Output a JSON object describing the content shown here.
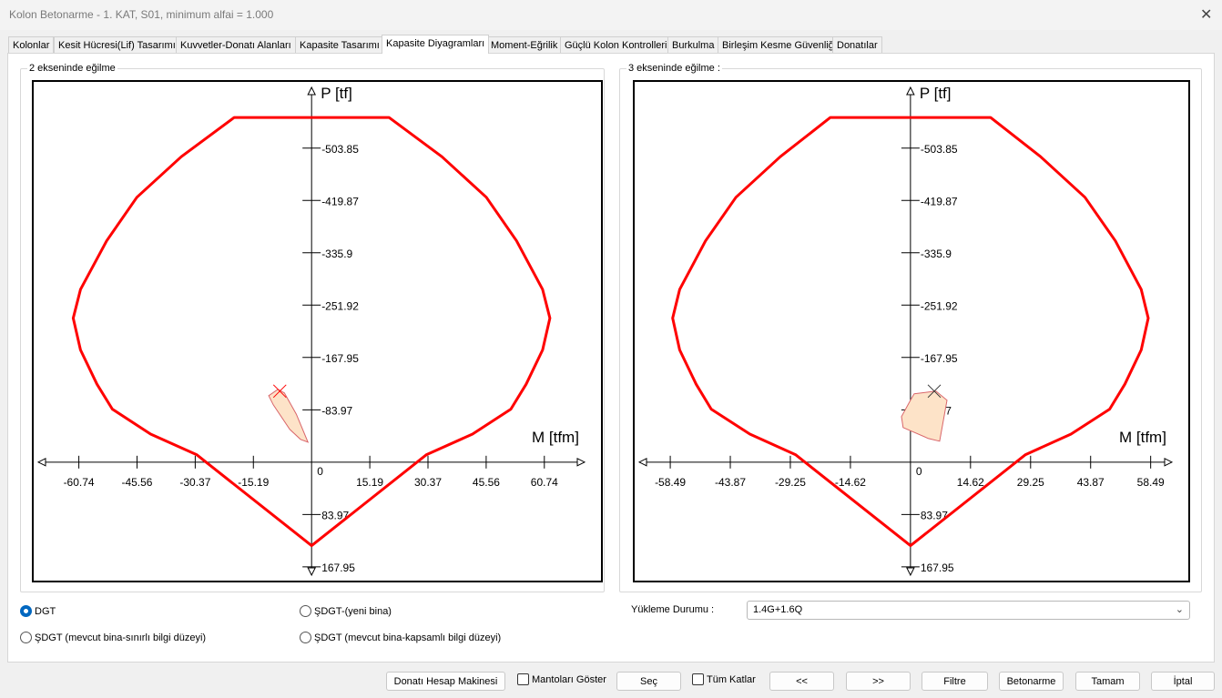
{
  "window": {
    "title": "Kolon Betonarme - 1. KAT, S01, minimum alfai = 1.000",
    "close_icon": "close-icon"
  },
  "tabs": [
    {
      "label": "Kolonlar"
    },
    {
      "label": "Kesit Hücresi(Lif) Tasarımı"
    },
    {
      "label": "Kuvvetler-Donatı Alanları"
    },
    {
      "label": "Kapasite Tasarımı"
    },
    {
      "label": "Kapasite Diyagramları",
      "active": true
    },
    {
      "label": "Moment-Eğrilik"
    },
    {
      "label": "Güçlü Kolon Kontrolleri"
    },
    {
      "label": "Burkulma"
    },
    {
      "label": "Birleşim Kesme Güvenliği"
    },
    {
      "label": "Donatılar"
    }
  ],
  "chart_data": [
    {
      "type": "line",
      "title": "2 ekseninde eğilme",
      "xlabel": "M [tfm]",
      "ylabel": "P [tf]",
      "xlim": [
        -73,
        76
      ],
      "ylim": [
        -613,
        193
      ],
      "y_inverted": true,
      "grid": false,
      "curve_color": "#ff0000",
      "x_ticks": [
        "-60.74",
        "-45.56",
        "-30.37",
        "-15.19",
        "0",
        "15.19",
        "30.37",
        "45.56",
        "60.74"
      ],
      "y_ticks": [
        "-503.85",
        "-419.87",
        "-335.9",
        "-251.92",
        "-167.95",
        "-83.97",
        "83.97",
        "167.95"
      ],
      "capacity_curve": [
        [
          -20.2,
          -553
        ],
        [
          -34,
          -490
        ],
        [
          -45.6,
          -425
        ],
        [
          -53.5,
          -355
        ],
        [
          -60.3,
          -277
        ],
        [
          -62.2,
          -231
        ],
        [
          -60.3,
          -180
        ],
        [
          -56,
          -125
        ],
        [
          -52,
          -85
        ],
        [
          -42,
          -45
        ],
        [
          -30,
          -12
        ],
        [
          0,
          134
        ],
        [
          30,
          -12
        ],
        [
          42,
          -45
        ],
        [
          52,
          -85
        ],
        [
          56,
          -125
        ],
        [
          60.3,
          -180
        ],
        [
          62.2,
          -231
        ],
        [
          60.3,
          -277
        ],
        [
          53.5,
          -355
        ],
        [
          45.6,
          -425
        ],
        [
          34,
          -490
        ],
        [
          20.2,
          -553
        ]
      ],
      "load_region": [
        [
          -11.2,
          -106.6
        ],
        [
          -8.8,
          -116.8
        ],
        [
          -7.1,
          -111
        ],
        [
          -4,
          -77
        ],
        [
          -0.95,
          -32
        ],
        [
          -2.9,
          -36.5
        ],
        [
          -5.7,
          -52.6
        ],
        [
          -10,
          -92
        ]
      ],
      "load_point": [
        -8.3,
        -113.9
      ]
    },
    {
      "type": "line",
      "title": "3 ekseninde eğilme :",
      "xlabel": "M [tfm]",
      "ylabel": "P [tf]",
      "xlim": [
        -67.6,
        68.1
      ],
      "ylim": [
        -613,
        193
      ],
      "y_inverted": true,
      "grid": false,
      "curve_color": "#ff0000",
      "x_ticks": [
        "-58.49",
        "-43.87",
        "-29.25",
        "-14.62",
        "0",
        "14.62",
        "29.25",
        "43.87",
        "58.49"
      ],
      "y_ticks": [
        "-503.85",
        "-419.87",
        "-335.9",
        "-251.92",
        "-167.95",
        "-83.97",
        "83.97",
        "167.95"
      ],
      "capacity_curve": [
        [
          -19.5,
          -553
        ],
        [
          -31.7,
          -490
        ],
        [
          -42.5,
          -425
        ],
        [
          -49.9,
          -355
        ],
        [
          -56.2,
          -277
        ],
        [
          -57.9,
          -231
        ],
        [
          -56.2,
          -180
        ],
        [
          -52.2,
          -125
        ],
        [
          -48.5,
          -85
        ],
        [
          -39.1,
          -45
        ],
        [
          -28,
          -12
        ],
        [
          0,
          134
        ],
        [
          28,
          -12
        ],
        [
          39.1,
          -45
        ],
        [
          48.5,
          -85
        ],
        [
          52.2,
          -125
        ],
        [
          56.2,
          -180
        ],
        [
          57.9,
          -231
        ],
        [
          56.2,
          -277
        ],
        [
          49.9,
          -355
        ],
        [
          42.5,
          -425
        ],
        [
          31.7,
          -490
        ],
        [
          19.5,
          -553
        ]
      ],
      "load_region": [
        [
          0.9,
          -109.5
        ],
        [
          6.2,
          -113.9
        ],
        [
          8.9,
          -99.3
        ],
        [
          7.1,
          -33.6
        ],
        [
          4.4,
          -37.9
        ],
        [
          -1.8,
          -55.5
        ],
        [
          -2.2,
          -73
        ],
        [
          0,
          -99.3
        ]
      ],
      "load_point": [
        5.8,
        -113.9
      ]
    }
  ],
  "options": {
    "radios": [
      {
        "label": "DGT",
        "checked": true
      },
      {
        "label": "ŞDGT-(yeni bina)",
        "checked": false
      },
      {
        "label": "ŞDGT (mevcut bina-sınırlı bilgi düzeyi)",
        "checked": false
      },
      {
        "label": "ŞDGT (mevcut bina-kapsamlı bilgi düzeyi)",
        "checked": false
      }
    ],
    "load_case_label": "Yükleme Durumu :",
    "load_case_value": "1.4G+1.6Q"
  },
  "footer": {
    "calc": "Donatı Hesap Makinesi",
    "show_jackets": "Mantoları Göster",
    "select": "Seç",
    "all_floors": "Tüm Katlar",
    "prev": "<<",
    "next": ">>",
    "filter": "Filtre",
    "concrete": "Betonarme",
    "ok": "Tamam",
    "cancel": "İptal"
  }
}
